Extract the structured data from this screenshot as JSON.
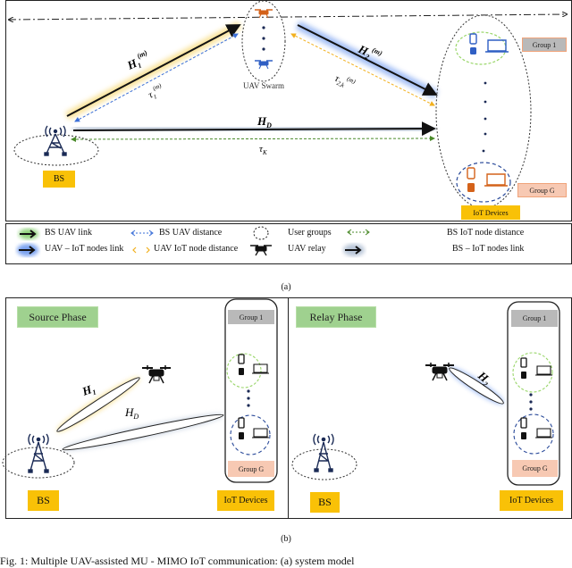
{
  "panel_a": {
    "uav_swarm_label": "UAV Swarm",
    "bs_label": "BS",
    "iot_devices_label": "IoT Devices",
    "group_first_label": "Group 1",
    "group_last_label": "Group G",
    "links": {
      "h1": "H",
      "h1_sub": "1",
      "h1_sup": "(m)",
      "tau1": "τ",
      "tau1_sub": "1",
      "tau1_sup": "(m)",
      "h2": "H",
      "h2_sub": "2",
      "h2_sup": "(m)",
      "tau2": "τ",
      "tau2_sub": "2,k",
      "tau2_sup": "(m)",
      "hd": "H",
      "hd_sub": "D",
      "tauk": "τ",
      "tauk_sub": "K"
    },
    "caption": "(a)"
  },
  "legend": {
    "items": [
      {
        "icon": "green-glow-arrow-icon",
        "label": "BS   UAV link"
      },
      {
        "icon": "blue-dashed-double-arrow-icon",
        "label": "BS   UAV distance"
      },
      {
        "icon": "dashed-circle-icon",
        "label": "User groups"
      },
      {
        "icon": "green-dashed-double-arrow-icon",
        "label": "BS   IoT node distance"
      },
      {
        "icon": "blue-glow-arrow-icon",
        "label": "UAV – IoT nodes link"
      },
      {
        "icon": "yellow-dashed-double-arrow-icon",
        "label": "UAV   IoT node distance"
      },
      {
        "icon": "drone-icon",
        "label": "UAV relay"
      },
      {
        "icon": "grey-glow-arrow-icon",
        "label": "BS – IoT nodes link"
      }
    ]
  },
  "panel_b": {
    "source_phase": {
      "title": "Source Phase",
      "h1": "H",
      "h1_sub": "1",
      "hd": "H",
      "hd_sub": "D",
      "bs_label": "BS",
      "iot_devices_label": "IoT Devices",
      "group_first_label": "Group 1",
      "group_last_label": "Group G"
    },
    "relay_phase": {
      "title": "Relay Phase",
      "h2": "H",
      "h2_sub": "2",
      "bs_label": "BS",
      "iot_devices_label": "IoT Devices",
      "group_first_label": "Group 1",
      "group_last_label": "Group G"
    },
    "caption": "(b)"
  },
  "figure_caption": "Fig. 1: Multiple UAV-assisted MU - MIMO IoT communication: (a) system model"
}
